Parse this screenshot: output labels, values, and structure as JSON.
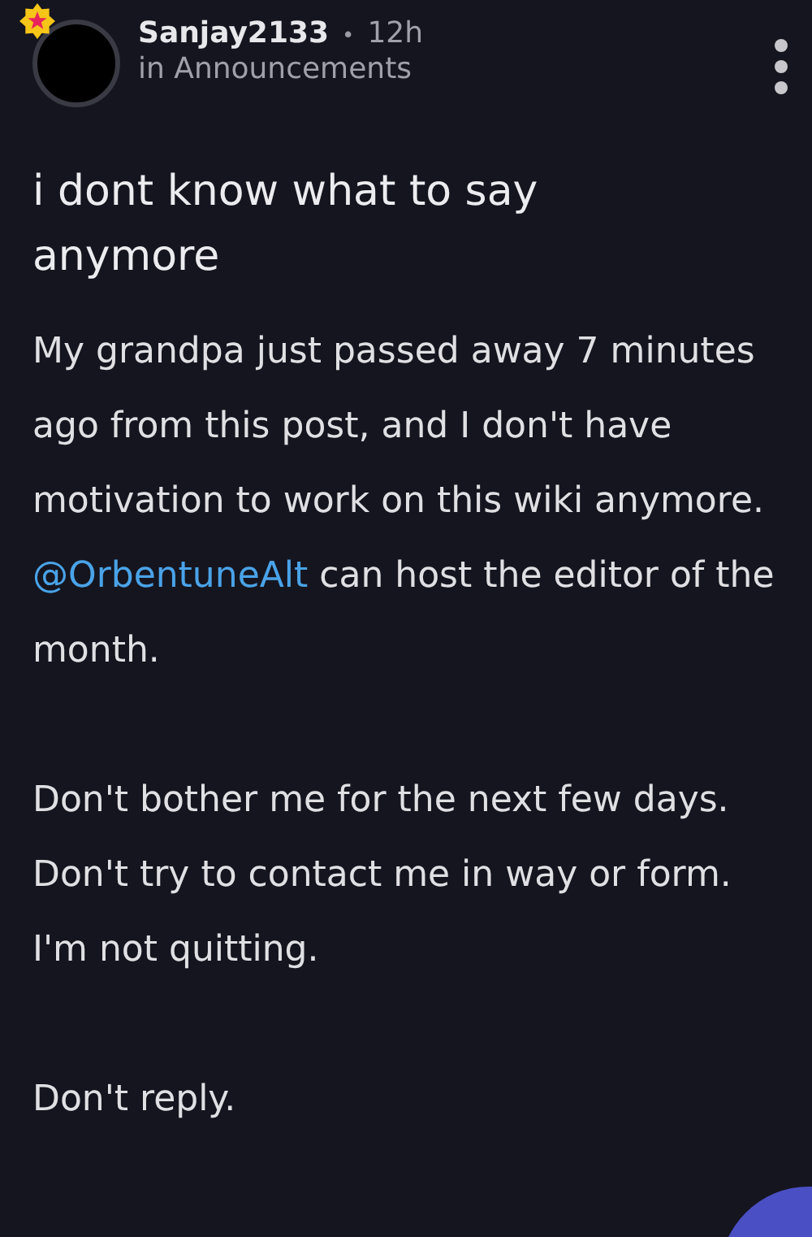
{
  "post": {
    "author": "Sanjay2133",
    "separator": "•",
    "time": "12h",
    "community": "in Announcements",
    "title": "i dont know what to say anymore",
    "blocks": [
      {
        "lines": [
          {
            "parts": [
              {
                "kind": "text",
                "text": "My grandpa just passed away 7 minutes ago from this post, and I don't have motivation to work on this wiki anymore. "
              },
              {
                "kind": "mention",
                "text": "@OrbentuneAlt"
              },
              {
                "kind": "text",
                "text": " can host the editor of the month."
              }
            ]
          }
        ]
      },
      {
        "lines": [
          {
            "parts": [
              {
                "kind": "text",
                "text": "Don't bother me for the next few days. Don't try to contact me in way or form."
              }
            ]
          },
          {
            "parts": [
              {
                "kind": "text",
                "text": "I'm not quitting."
              }
            ]
          }
        ]
      },
      {
        "lines": [
          {
            "parts": [
              {
                "kind": "text",
                "text": "Don't reply."
              }
            ]
          }
        ]
      }
    ]
  }
}
